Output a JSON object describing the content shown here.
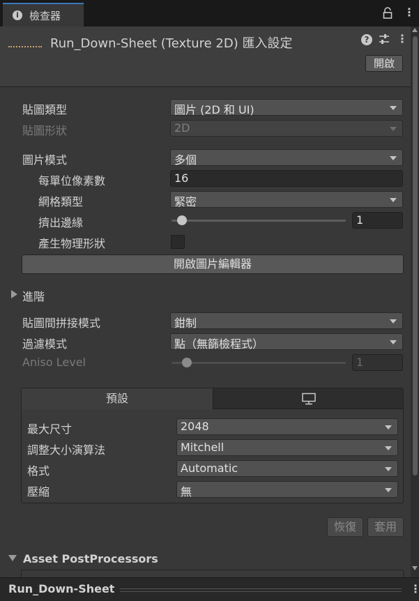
{
  "tab": {
    "title": "檢查器"
  },
  "header": {
    "title": "Run_Down-Sheet (Texture 2D) 匯入設定",
    "open_label": "開啟"
  },
  "fields": {
    "texture_type": {
      "label": "貼圖類型",
      "value": "圖片 (2D 和 UI)"
    },
    "texture_shape": {
      "label": "貼圖形狀",
      "value": "2D"
    },
    "sprite_mode": {
      "label": "圖片模式",
      "value": "多個"
    },
    "pixels_per_unit": {
      "label": "每單位像素數",
      "value": "16"
    },
    "mesh_type": {
      "label": "網格類型",
      "value": "緊密"
    },
    "extrude_edges": {
      "label": "擠出邊緣",
      "value": "1",
      "slider_fraction": 0.03
    },
    "generate_physics": {
      "label": "產生物理形狀",
      "checked": false
    },
    "open_sprite_editor": {
      "label": "開啟圖片編輯器"
    },
    "advanced": {
      "label": "進階"
    },
    "wrap_mode": {
      "label": "貼圖間拼接模式",
      "value": "鉗制"
    },
    "filter_mode": {
      "label": "過濾模式",
      "value": "點（無篩檢程式）"
    },
    "aniso_level": {
      "label": "Aniso Level",
      "value": "1",
      "slider_fraction": 0.06
    }
  },
  "platform": {
    "tabs": {
      "default": "預設",
      "standalone_icon": "monitor-icon"
    },
    "max_size": {
      "label": "最大尺寸",
      "value": "2048"
    },
    "resize_algorithm": {
      "label": "調整大小演算法",
      "value": "Mitchell"
    },
    "format": {
      "label": "格式",
      "value": "Automatic"
    },
    "compression": {
      "label": "壓縮",
      "value": "無"
    }
  },
  "actions": {
    "revert_label": "恢復",
    "apply_label": "套用"
  },
  "postprocessors": {
    "label": "Asset PostProcessors"
  },
  "footer": {
    "title": "Run_Down-Sheet"
  }
}
